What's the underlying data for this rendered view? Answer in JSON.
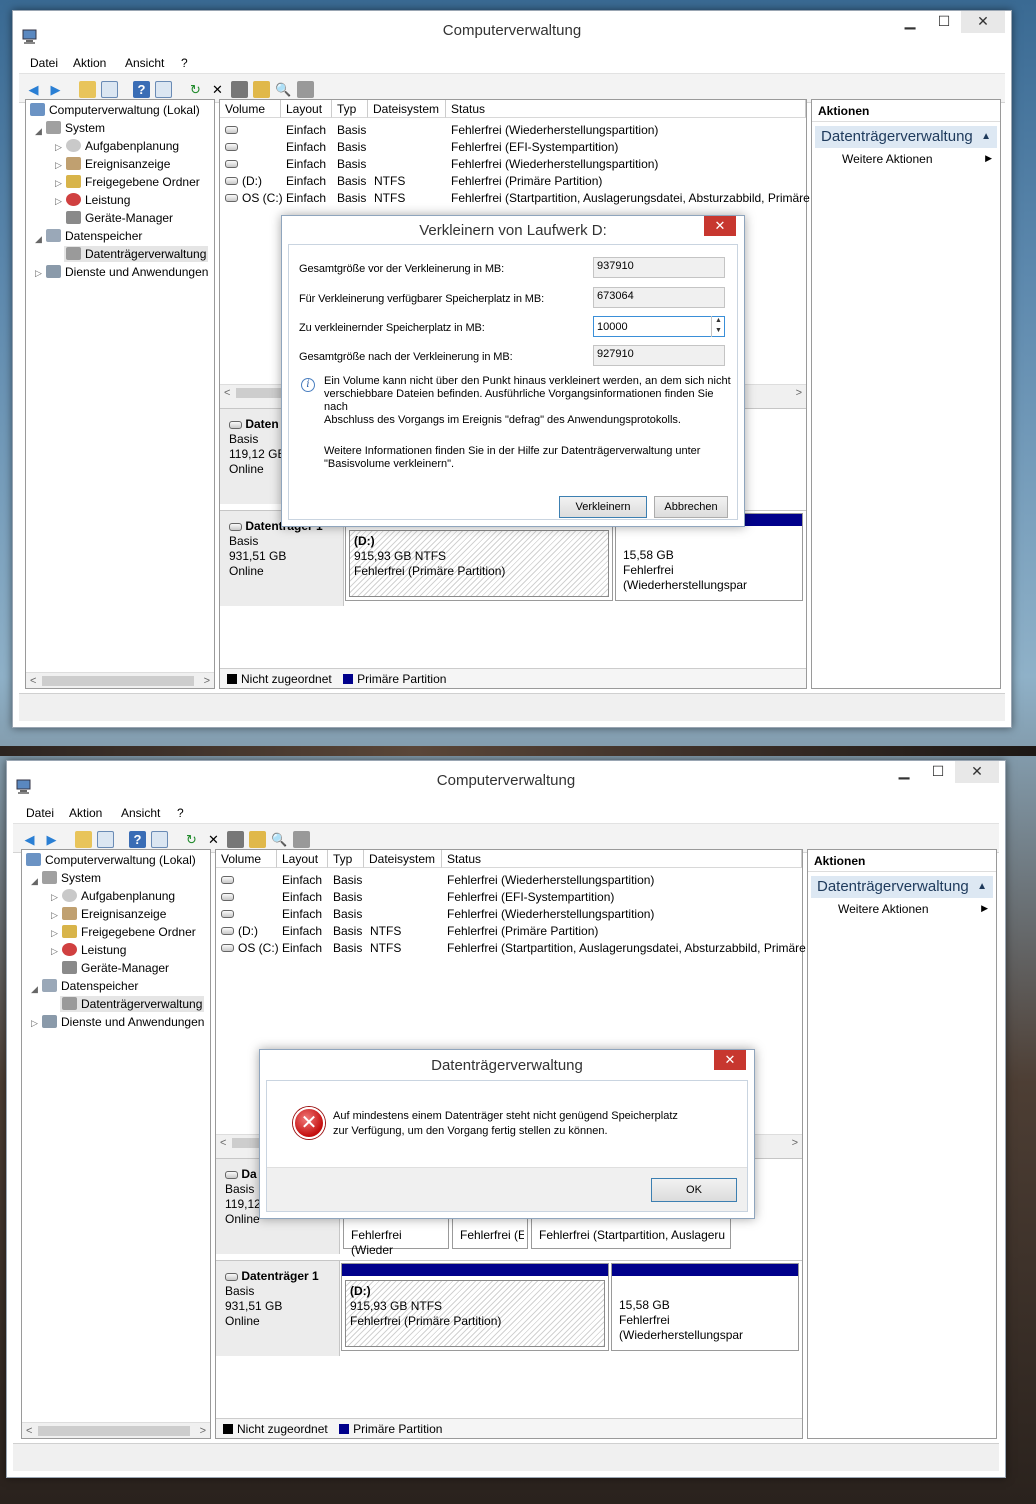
{
  "window": {
    "title": "Computerverwaltung",
    "minimize": "▁",
    "maximize": "☐",
    "close": "✕"
  },
  "menu": [
    "Datei",
    "Aktion",
    "Ansicht",
    "?"
  ],
  "tree": [
    {
      "label": "Computerverwaltung (Lokal)",
      "level": 0
    },
    {
      "label": "System",
      "level": 1
    },
    {
      "label": "Aufgabenplanung",
      "level": 2
    },
    {
      "label": "Ereignisanzeige",
      "level": 2
    },
    {
      "label": "Freigegebene Ordner",
      "level": 2
    },
    {
      "label": "Leistung",
      "level": 2
    },
    {
      "label": "Geräte-Manager",
      "level": 2
    },
    {
      "label": "Datenspeicher",
      "level": 1
    },
    {
      "label": "Datenträgerverwaltung",
      "level": 2
    },
    {
      "label": "Dienste und Anwendungen",
      "level": 1
    }
  ],
  "volume_table": {
    "headers": [
      "Volume",
      "Layout",
      "Typ",
      "Dateisystem",
      "Status"
    ],
    "rows": [
      {
        "volume": "",
        "layout": "Einfach",
        "type": "Basis",
        "fs": "",
        "status": "Fehlerfrei (Wiederherstellungspartition)"
      },
      {
        "volume": "",
        "layout": "Einfach",
        "type": "Basis",
        "fs": "",
        "status": "Fehlerfrei (EFI-Systempartition)"
      },
      {
        "volume": "",
        "layout": "Einfach",
        "type": "Basis",
        "fs": "",
        "status": "Fehlerfrei (Wiederherstellungspartition)"
      },
      {
        "volume": "(D:)",
        "layout": "Einfach",
        "type": "Basis",
        "fs": "NTFS",
        "status": "Fehlerfrei (Primäre Partition)"
      },
      {
        "volume": "OS (C:)",
        "layout": "Einfach",
        "type": "Basis",
        "fs": "NTFS",
        "status": "Fehlerfrei (Startpartition, Auslagerungsdatei, Absturzabbild, Primäre"
      }
    ]
  },
  "actions": {
    "header": "Aktionen",
    "section": "Datenträgerverwaltung",
    "item": "Weitere Aktionen"
  },
  "legend": {
    "unallocated": "Nicht zugeordnet",
    "primary": "Primäre Partition"
  },
  "disk0": {
    "name_top": "Daten",
    "name_bottom": "Da",
    "type": "Basis",
    "size_top": "119,12 GB",
    "size_bottom": "119,12",
    "status": "Online",
    "parts": [
      "Fehlerfrei (Wieder",
      "Fehlerfrei (E",
      "Fehlerfrei (Startpartition, Auslageru"
    ]
  },
  "disk1": {
    "name": "Datenträger 1",
    "name_top": "Datenträger 1",
    "type": "Basis",
    "size": "931,51 GB",
    "status": "Online",
    "part_d": {
      "label": "(D:)",
      "size": "915,93 GB NTFS",
      "status": "Fehlerfrei (Primäre Partition)"
    },
    "part_r": {
      "size": "15,58 GB",
      "status": "Fehlerfrei (Wiederherstellungspar"
    }
  },
  "shrink_dialog": {
    "title": "Verkleinern von Laufwerk D:",
    "close": "✕",
    "fields": [
      {
        "label": "Gesamtgröße vor der Verkleinerung in MB:",
        "value": "937910"
      },
      {
        "label": "Für Verkleinerung verfügbarer Speicherplatz in MB:",
        "value": "673064"
      },
      {
        "label": "Zu verkleinernder Speicherplatz in MB:",
        "value": "10000"
      },
      {
        "label": "Gesamtgröße nach der Verkleinerung in MB:",
        "value": "927910"
      }
    ],
    "info_1": "Ein Volume kann nicht über den Punkt hinaus verkleinert werden, an dem sich nicht",
    "info_2": "verschiebbare Dateien befinden. Ausführliche Vorgangsinformationen finden Sie nach",
    "info_3": "Abschluss des Vorgangs im Ereignis \"defrag\" des Anwendungsprotokolls.",
    "help_1": "Weitere Informationen finden Sie in der Hilfe zur Datenträgerverwaltung unter",
    "help_2": "\"Basisvolume verkleinern\".",
    "btn_ok": "Verkleinern",
    "btn_cancel": "Abbrechen"
  },
  "error_dialog": {
    "title": "Datenträgerverwaltung",
    "close": "✕",
    "message_1": "Auf mindestens einem Datenträger steht nicht genügend Speicherplatz",
    "message_2": "zur Verfügung, um den Vorgang fertig stellen zu können.",
    "btn_ok": "OK",
    "icon": "error-icon"
  },
  "colors": {
    "primary_partition": "#00008b",
    "unallocated": "#000000",
    "actions_section": "#dde8f3",
    "dialog_close": "#c7372f"
  }
}
